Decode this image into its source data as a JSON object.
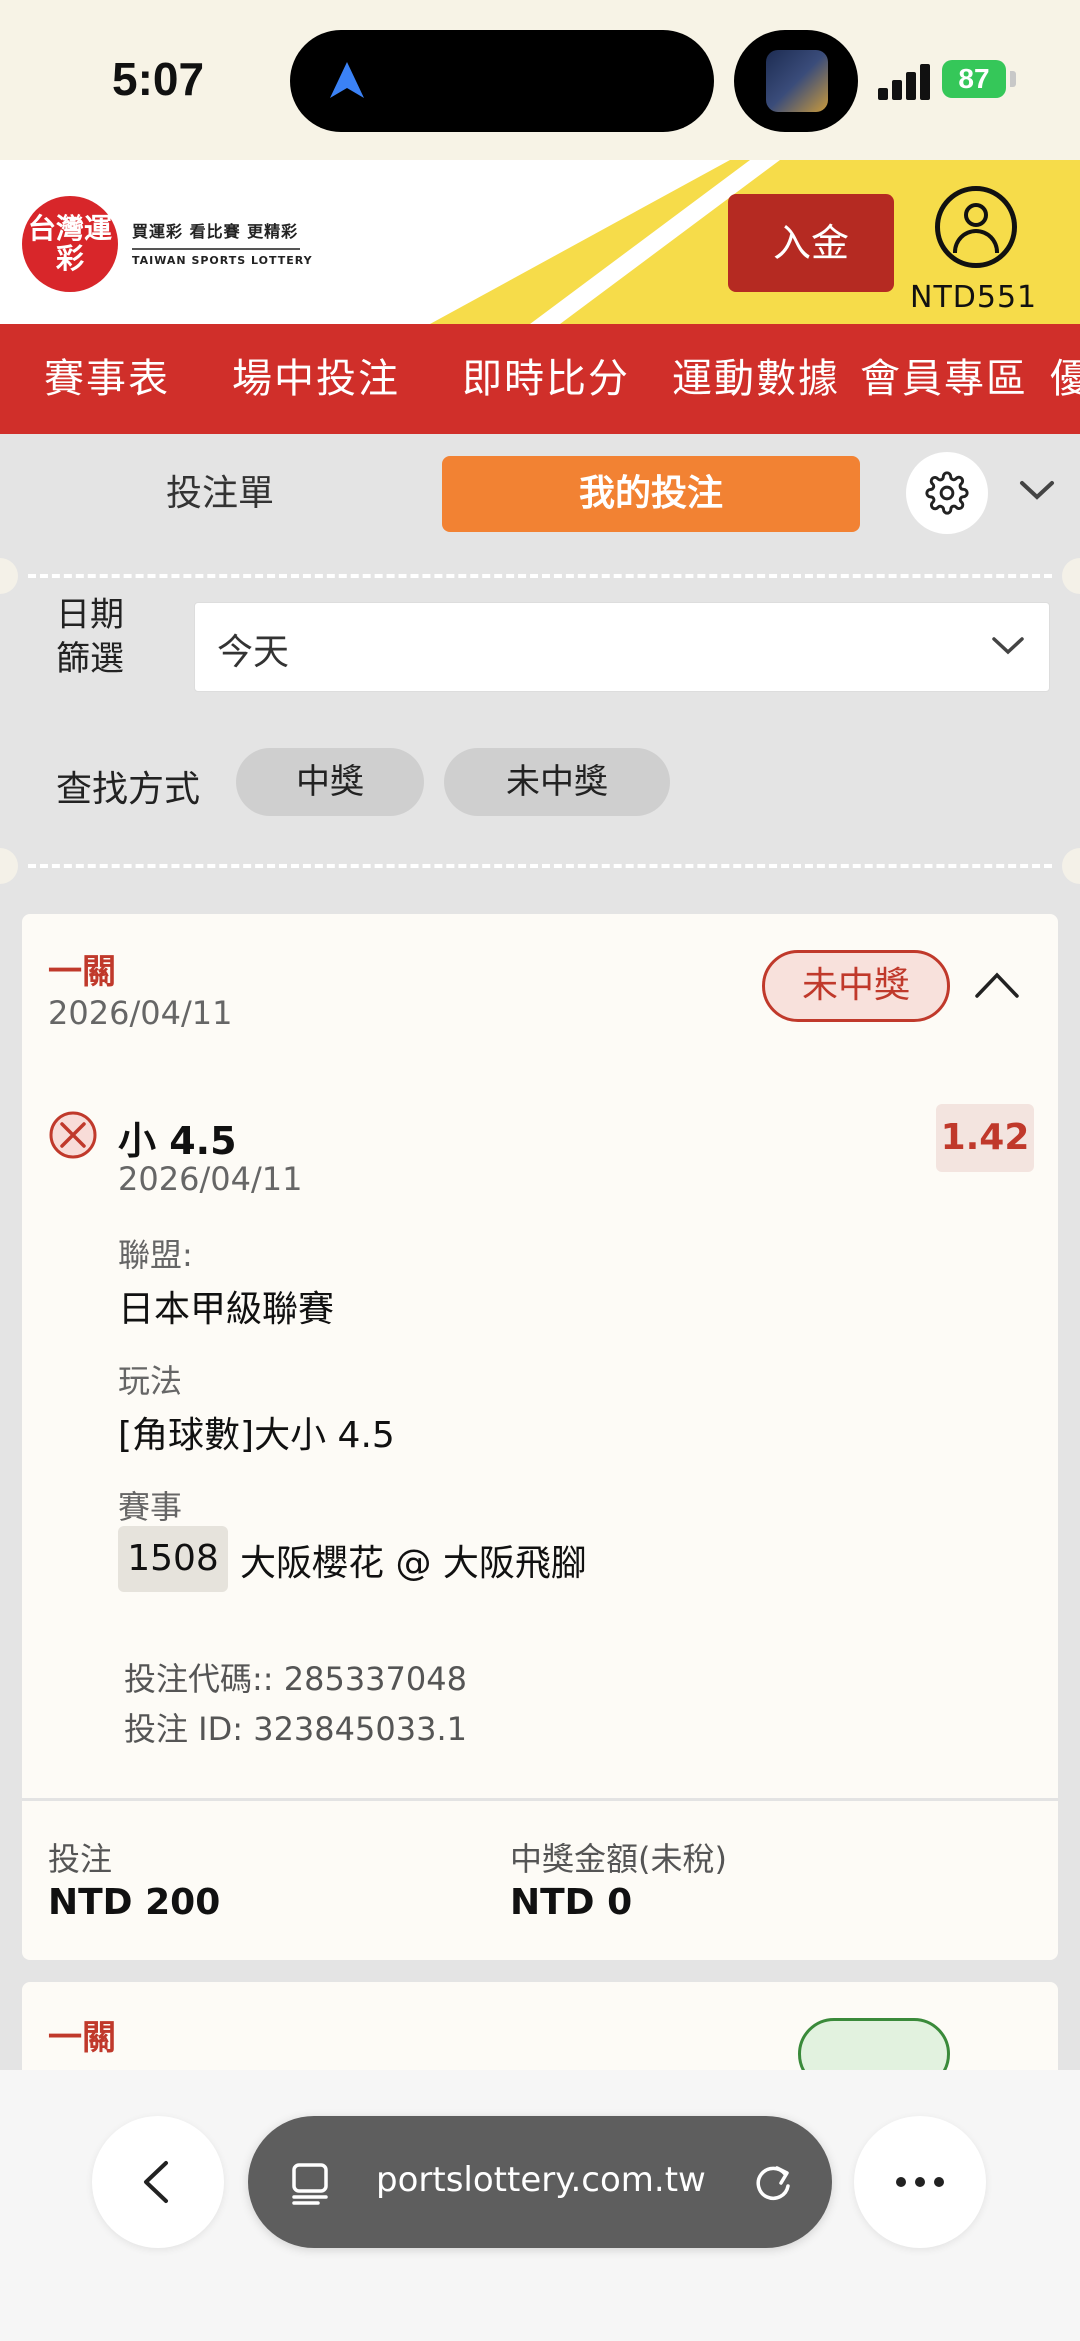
{
  "status_bar": {
    "time": "5:07",
    "battery": "87"
  },
  "header": {
    "logo_text": "台灣運彩",
    "logo_tagline": "買運彩 看比賽 更精彩",
    "logo_en": "TAIWAN SPORTS LOTTERY",
    "deposit_label": "入金",
    "balance": "NTD551"
  },
  "nav": {
    "items": [
      "賽事表",
      "場中投注",
      "即時比分",
      "運動數據",
      "會員專區",
      "優"
    ]
  },
  "bet_panel": {
    "tabs": {
      "betslip": "投注單",
      "my_bets": "我的投注"
    },
    "filter": {
      "date_label_top": "日期",
      "date_label_bottom": "篩選",
      "date_value": "今天",
      "search_label": "查找方式",
      "chips": [
        "中獎",
        "未中獎"
      ]
    }
  },
  "bet_card": {
    "type": "一關",
    "date": "2026/04/11",
    "status": "未中獎",
    "selection": {
      "name": "小 4.5",
      "date": "2026/04/11",
      "odds": "1.42"
    },
    "league_label": "聯盟:",
    "league": "日本甲級聯賽",
    "market_label": "玩法",
    "market": "[角球數]大小 4.5",
    "match_label": "賽事",
    "match_id": "1508",
    "match": "大阪櫻花 @ 大阪飛腳",
    "bet_code": "投注代碼:: 285337048",
    "bet_id": "投注 ID: 323845033.1",
    "stake_label": "投注",
    "stake": "NTD 200",
    "payout_label": "中獎金額(未稅)",
    "payout": "NTD 0"
  },
  "next_card": {
    "type": "一關"
  },
  "browser": {
    "url": "portslottery.com.tw"
  },
  "colors": {
    "brand_red": "#d02f2a",
    "accent_orange": "#f28233",
    "brand_yellow": "#f6dc4a"
  },
  "icons": [
    "location-arrow-icon",
    "gear-icon",
    "chevron-down-icon",
    "chevron-up-icon",
    "close-circle-icon",
    "back-icon",
    "tabs-icon",
    "reload-icon",
    "more-icon",
    "profile-icon"
  ]
}
